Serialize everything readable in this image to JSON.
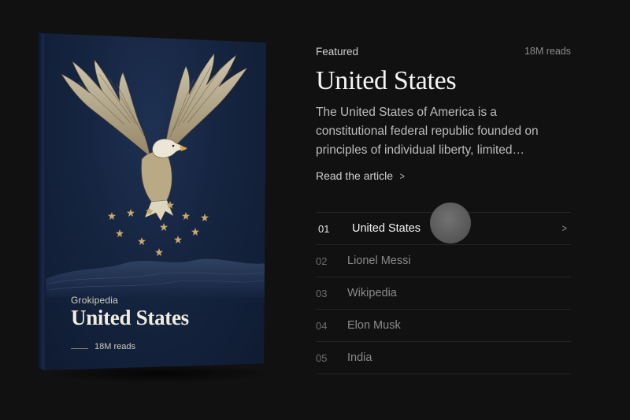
{
  "book": {
    "brand": "Grokipedia",
    "title": "United States",
    "reads": "18M reads"
  },
  "featured": {
    "label": "Featured",
    "reads": "18M reads",
    "title": "United States",
    "description": "The United States of America is a constitutional federal republic founded on principles of individual liberty, limited…",
    "link_label": "Read the article",
    "link_icon": "chevron-right-icon"
  },
  "list": [
    {
      "num": "01",
      "label": "United States",
      "active": true
    },
    {
      "num": "02",
      "label": "Lionel Messi",
      "active": false
    },
    {
      "num": "03",
      "label": "Wikipedia",
      "active": false
    },
    {
      "num": "04",
      "label": "Elon Musk",
      "active": false
    },
    {
      "num": "05",
      "label": "India",
      "active": false
    }
  ],
  "colors": {
    "background": "#111111",
    "book_cover": "#15243f",
    "gold": "#c8a76a"
  }
}
